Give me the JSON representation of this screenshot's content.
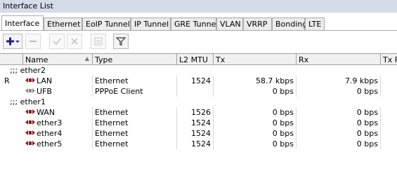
{
  "window": {
    "title": "Interface List"
  },
  "tabs": [
    {
      "label": "Interface",
      "active": true
    },
    {
      "label": "Ethernet"
    },
    {
      "label": "EoIP Tunnel"
    },
    {
      "label": "IP Tunnel"
    },
    {
      "label": "GRE Tunnel"
    },
    {
      "label": "VLAN"
    },
    {
      "label": "VRRP"
    },
    {
      "label": "Bonding"
    },
    {
      "label": "LTE"
    }
  ],
  "toolbar": {
    "add_icon": "plus-dropdown-icon",
    "remove_icon": "minus-icon",
    "enable_icon": "check-icon",
    "disable_icon": "x-icon",
    "comment_icon": "comment-icon",
    "filter_icon": "filter-icon"
  },
  "table": {
    "columns": [
      "Name",
      "Type",
      "L2 MTU",
      "Tx",
      "Rx",
      "Tx P"
    ],
    "sort_indicator": "▲",
    "groups": [
      {
        "comment": ";;; ether2",
        "rows": [
          {
            "flag": "R",
            "name": "LAN",
            "type": "Ethernet",
            "l2mtu": "1524",
            "tx": "58.7 kbps",
            "rx": "7.9 kbps",
            "icon": "ethernet-icon"
          },
          {
            "flag": "",
            "name": "UFB",
            "type": "PPPoE Client",
            "l2mtu": "",
            "tx": "0 bps",
            "rx": "0 bps",
            "icon": "pppoe-icon"
          }
        ]
      },
      {
        "comment": ";;; ether1",
        "rows": [
          {
            "flag": "",
            "name": "WAN",
            "type": "Ethernet",
            "l2mtu": "1526",
            "tx": "0 bps",
            "rx": "0 bps",
            "icon": "ethernet-icon"
          },
          {
            "flag": "",
            "name": "ether3",
            "type": "Ethernet",
            "l2mtu": "1524",
            "tx": "0 bps",
            "rx": "0 bps",
            "icon": "ethernet-icon"
          },
          {
            "flag": "",
            "name": "ether4",
            "type": "Ethernet",
            "l2mtu": "1524",
            "tx": "0 bps",
            "rx": "0 bps",
            "icon": "ethernet-icon"
          },
          {
            "flag": "",
            "name": "ether5",
            "type": "Ethernet",
            "l2mtu": "1524",
            "tx": "0 bps",
            "rx": "0 bps",
            "icon": "ethernet-icon"
          }
        ]
      }
    ]
  },
  "colors": {
    "title_bar": "#d6dbe9",
    "add_button": "#1a237e",
    "iface_icon": "#8b1a1a"
  }
}
